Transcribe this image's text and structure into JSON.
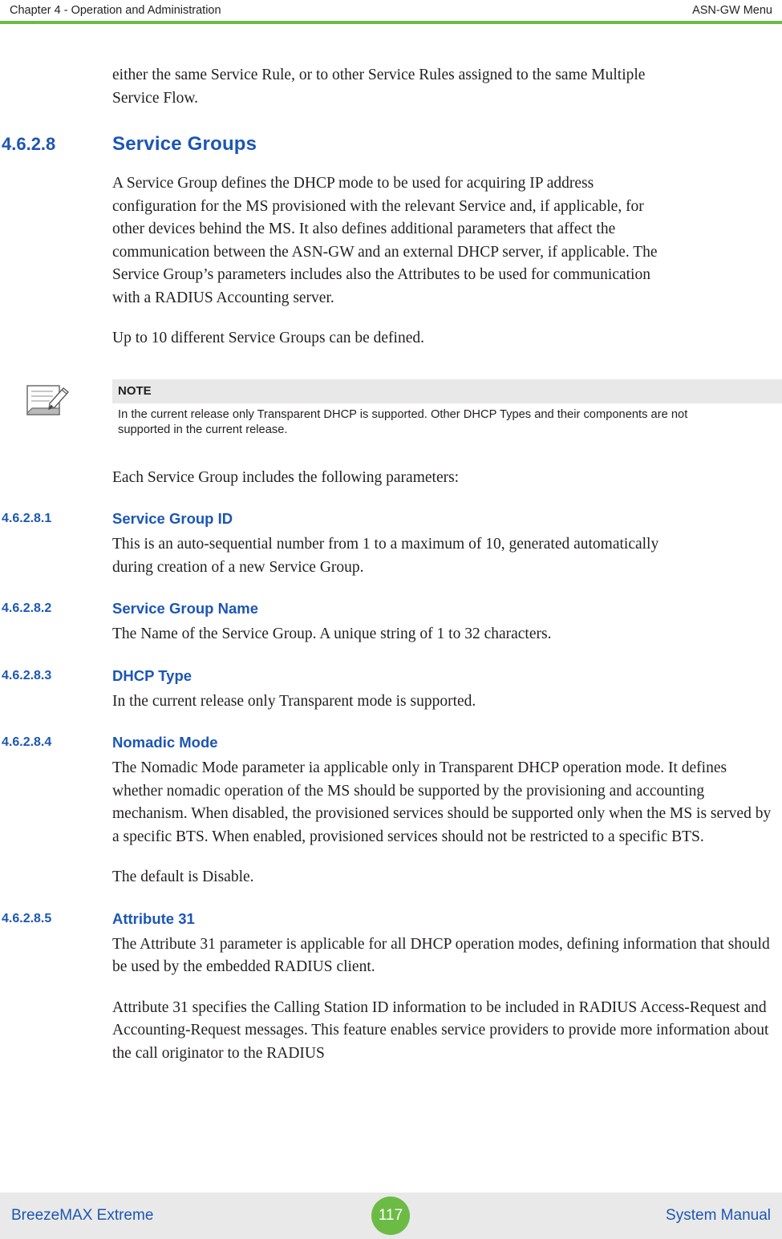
{
  "header": {
    "left": "Chapter 4 - Operation and Administration",
    "right": "ASN-GW Menu",
    "rule_color": "#6cbb45"
  },
  "intro": {
    "paragraph": "either the same Service Rule, or to other Service Rules assigned to the same Multiple Service Flow."
  },
  "sections": [
    {
      "number": "4.6.2.8",
      "title": "Service Groups",
      "paragraphs": [
        "A Service Group defines the DHCP mode to be used for acquiring IP address configuration for the MS provisioned with the relevant Service and, if applicable, for other devices behind the MS. It also defines additional parameters that affect the communication between the ASN-GW and an external DHCP server, if applicable. The Service Group’s parameters includes also the Attributes to be used for communication with a RADIUS Accounting server.",
        "Up to 10 different Service Groups can be defined."
      ]
    },
    {
      "number": "4.6.2.8.1",
      "title": "Service Group ID",
      "paragraphs": [
        "This is an auto-sequential number from 1 to a maximum of 10, generated automatically during creation of a new Service Group."
      ]
    },
    {
      "number": "4.6.2.8.2",
      "title": "Service Group Name",
      "paragraphs": [
        "The Name of the Service Group. A unique string of 1 to 32 characters."
      ]
    },
    {
      "number": "4.6.2.8.3",
      "title": "DHCP Type",
      "paragraphs": [
        "In the current release only Transparent mode is supported."
      ]
    },
    {
      "number": "4.6.2.8.4",
      "title": "Nomadic Mode",
      "paragraphs": [
        "The Nomadic Mode parameter ia applicable only in Transparent DHCP operation mode. It defines whether nomadic operation of the MS should be supported by the provisioning and accounting mechanism. When disabled, the provisioned services should be supported only when the MS is served by a specific BTS. When enabled, provisioned services should not be restricted to a specific BTS.",
        "The default is Disable."
      ]
    },
    {
      "number": "4.6.2.8.5",
      "title": "Attribute 31",
      "paragraphs": [
        "The Attribute 31 parameter is applicable for all DHCP operation modes, defining information that should be used by the embedded RADIUS client.",
        "Attribute 31 specifies the Calling Station ID information to be included in RADIUS Access-Request and Accounting-Request messages. This feature enables service providers to provide more information about the call originator to the RADIUS"
      ]
    }
  ],
  "note": {
    "label": "NOTE",
    "text": "In the current release only Transparent DHCP is supported. Other DHCP Types and their components are not supported in the current release.",
    "icon": "note-pencil-icon"
  },
  "post_note_paragraph": "Each Service Group includes the following parameters:",
  "footer": {
    "left": "BreezeMAX Extreme",
    "page": "117",
    "right": "System Manual",
    "badge_color": "#6cbb45",
    "text_color": "#1c56b4"
  }
}
